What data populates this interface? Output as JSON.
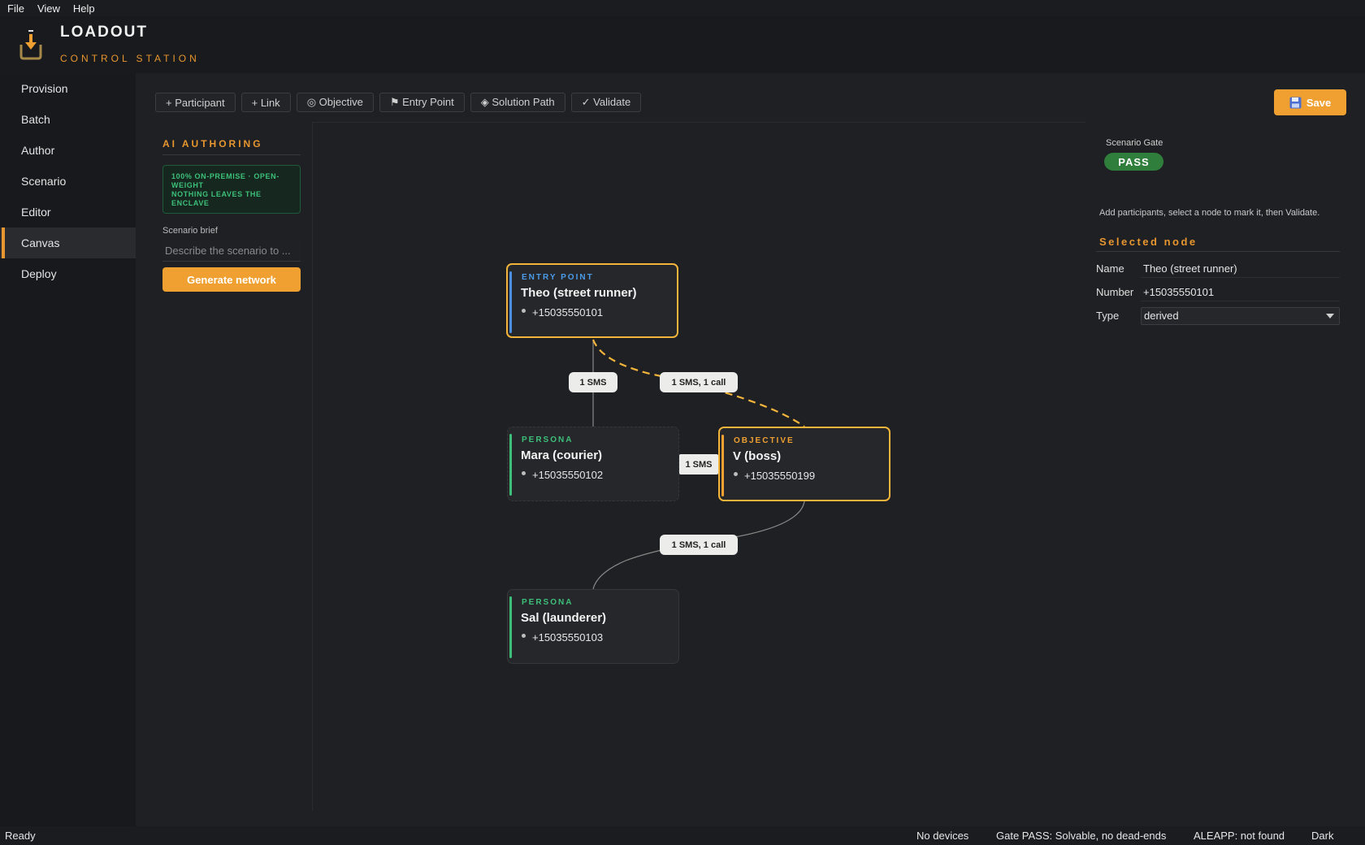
{
  "menu": [
    "File",
    "View",
    "Help"
  ],
  "app": {
    "title": "LOADOUT",
    "subtitle": "CONTROL STATION"
  },
  "sidebar": {
    "items": [
      {
        "label": "Provision"
      },
      {
        "label": "Batch"
      },
      {
        "label": "Author"
      },
      {
        "label": "Scenario"
      },
      {
        "label": "Editor"
      },
      {
        "label": "Canvas",
        "active": true
      },
      {
        "label": "Deploy"
      }
    ]
  },
  "toolbar": {
    "buttons": [
      {
        "icon": "plus-icon",
        "label": "+ Participant"
      },
      {
        "icon": "plus-icon",
        "label": "+ Link"
      },
      {
        "icon": "target-icon",
        "label": "◎ Objective"
      },
      {
        "icon": "flag-icon",
        "label": "⚑ Entry Point"
      },
      {
        "icon": "diamond-icon",
        "label": "◈ Solution Path"
      },
      {
        "icon": "check-icon",
        "label": "✓ Validate"
      }
    ],
    "save_label": "Save",
    "save_icon": "floppy-disk-icon"
  },
  "ai_authoring": {
    "title": "AI AUTHORING",
    "notice_line1": "100% ON-PREMISE · OPEN-WEIGHT",
    "notice_line2": "NOTHING LEAVES THE ENCLAVE",
    "brief_label": "Scenario brief",
    "brief_placeholder": "Describe the scenario to ...",
    "brief_value": "",
    "generate_label": "Generate network"
  },
  "canvas": {
    "nodes": [
      {
        "kind": "ENTRY POINT",
        "name": "Theo (street runner)",
        "number": "+15035550101",
        "selected": true,
        "kind_color": "#4a9be8",
        "bar_color": "#4a8fe0"
      },
      {
        "kind": "PERSONA",
        "name": "Mara (courier)",
        "number": "+15035550102",
        "selected": false,
        "kind_color": "#3dbf7a",
        "bar_color": "#3dbf7a"
      },
      {
        "kind": "OBJECTIVE",
        "name": "V (boss)",
        "number": "+15035550199",
        "selected": true,
        "kind_color": "#f0a030",
        "bar_color": "#f0a030"
      },
      {
        "kind": "PERSONA",
        "name": "Sal (launderer)",
        "number": "+15035550103",
        "selected": false,
        "kind_color": "#3dbf7a",
        "bar_color": "#3dbf7a"
      }
    ],
    "edges": [
      {
        "from": "Theo (street runner)",
        "to": "Mara (courier)",
        "label": "1 SMS",
        "solution_path": false
      },
      {
        "from": "Theo (street runner)",
        "to": "V (boss)",
        "label": "1 SMS, 1 call",
        "solution_path": true
      },
      {
        "from": "Mara (courier)",
        "to": "V (boss)",
        "label": "1 SMS",
        "solution_path": false
      },
      {
        "from": "V (boss)",
        "to": "Sal (launderer)",
        "label": "1 SMS, 1 call",
        "solution_path": false
      }
    ]
  },
  "inspector": {
    "gate_label": "Scenario Gate",
    "gate_status": "PASS",
    "hint": "Add participants, select a node to mark it, then Validate.",
    "selected_title": "Selected node",
    "name_label": "Name",
    "name_value": "Theo (street runner)",
    "number_label": "Number",
    "number_value": "+15035550101",
    "type_label": "Type",
    "type_value": "derived"
  },
  "status": {
    "left": "Ready",
    "devices": "No devices",
    "gate": "Gate PASS: Solvable, no dead-ends",
    "aleapp": "ALEAPP: not found",
    "theme": "Dark"
  },
  "colors": {
    "accent": "#f0a030",
    "pass": "#2f7e3c",
    "persona": "#3dbf7a",
    "entry": "#4a9be8"
  }
}
